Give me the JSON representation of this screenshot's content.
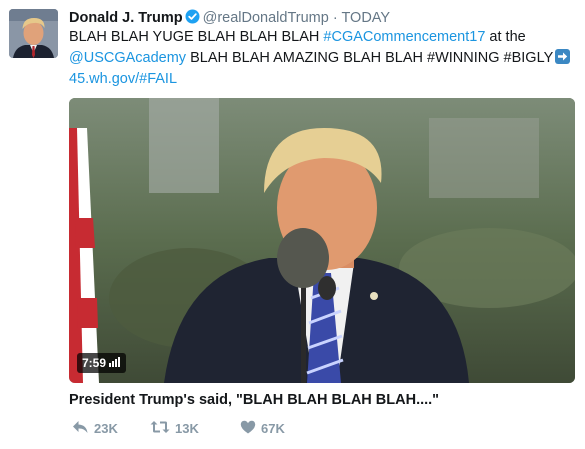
{
  "user": {
    "name": "Donald J. Trump",
    "handle": "@realDonaldTrump",
    "separator": "·",
    "time": "TODAY"
  },
  "tweet": {
    "segments": [
      {
        "text": "BLAH BLAH YUGE BLAH BLAH BLAH ",
        "type": "text"
      },
      {
        "text": "#CGACommencement17",
        "type": "link"
      },
      {
        "text": " at the ",
        "type": "text"
      },
      {
        "text": "@USCGAcademy",
        "type": "link"
      },
      {
        "text": " BLAH BLAH AMAZING BLAH BLAH #WINNING #BIGLY",
        "type": "text"
      },
      {
        "text": "",
        "type": "emoji",
        "icon": "right-arrow-emoji"
      },
      {
        "text": " ",
        "type": "text"
      },
      {
        "text": "45.wh.gov/#FAIL",
        "type": "link"
      }
    ]
  },
  "media": {
    "duration": "7:59"
  },
  "caption": "President Trump's said, \"BLAH BLAH BLAH BLAH....\"",
  "actions": {
    "replies": "23K",
    "retweets": "13K",
    "likes": "67K"
  },
  "colors": {
    "link": "#1b95e0",
    "muted": "#657786",
    "action": "#8899a6",
    "verified": "#1da1f2"
  }
}
